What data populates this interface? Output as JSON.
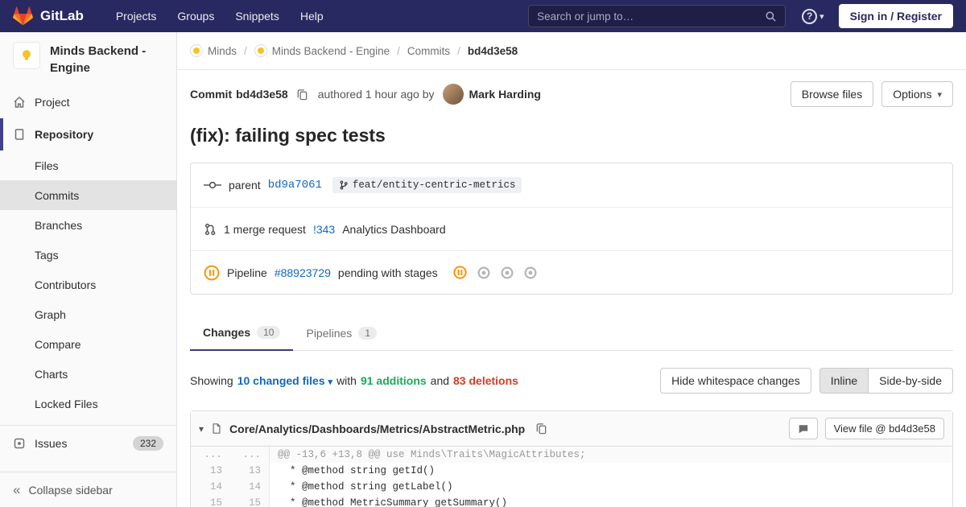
{
  "colors": {
    "navbar_bg": "#292961",
    "link_blue": "#1068bf",
    "additions_green": "#1aaa55",
    "deletions_red": "#db3b21",
    "pending_orange": "#fc9403"
  },
  "icons": {
    "caret_down": "▾",
    "collapse_left": "«",
    "help": "?",
    "crumb_separator": "/"
  },
  "navbar": {
    "brand": "GitLab",
    "items": [
      "Projects",
      "Groups",
      "Snippets",
      "Help"
    ],
    "search_placeholder": "Search or jump to…",
    "signin_label": "Sign in / Register"
  },
  "sidebar": {
    "project_title": "Minds Backend - Engine",
    "project_item": "Project",
    "repository_item": "Repository",
    "repo_children": [
      "Files",
      "Commits",
      "Branches",
      "Tags",
      "Contributors",
      "Graph",
      "Compare",
      "Charts",
      "Locked Files"
    ],
    "issues_label": "Issues",
    "issues_count": "232",
    "collapse_label": "Collapse sidebar"
  },
  "breadcrumb": {
    "crumbs": [
      "Minds",
      "Minds Backend - Engine",
      "Commits",
      "bd4d3e58"
    ]
  },
  "commit": {
    "label": "Commit",
    "sha": "bd4d3e58",
    "authored_text": "authored 1 hour ago by",
    "author": "Mark Harding",
    "browse_files_label": "Browse files",
    "options_label": "Options",
    "title": "(fix): failing spec tests",
    "parent_label": "parent",
    "parent_sha": "bd9a7061",
    "branch_ref": "feat/entity-centric-metrics",
    "mr_text": "1 merge request",
    "mr_id": "!343",
    "mr_title": "Analytics Dashboard",
    "pipeline_label": "Pipeline",
    "pipeline_id": "#88923729",
    "pipeline_status_text": "pending with stages"
  },
  "tabs": {
    "changes_label": "Changes",
    "changes_count": "10",
    "pipelines_label": "Pipelines",
    "pipelines_count": "1"
  },
  "summary": {
    "showing": "Showing",
    "changed_files": "10 changed files",
    "with_word": "with",
    "additions": "91 additions",
    "and_word": "and",
    "deletions": "83 deletions",
    "hide_whitespace_label": "Hide whitespace changes",
    "inline_label": "Inline",
    "side_by_side_label": "Side-by-side"
  },
  "file_diff": {
    "path": "Core/Analytics/Dashboards/Metrics/AbstractMetric.php",
    "view_file_label": "View file @ bd4d3e58",
    "lines": [
      {
        "old": "...",
        "new": "...",
        "code": "@@ -13,6 +13,8 @@ use Minds\\Traits\\MagicAttributes;"
      },
      {
        "old": "13",
        "new": "13",
        "code": "  * @method string getId()"
      },
      {
        "old": "14",
        "new": "14",
        "code": "  * @method string getLabel()"
      },
      {
        "old": "15",
        "new": "15",
        "code": "  * @method MetricSummary getSummary()"
      }
    ]
  }
}
